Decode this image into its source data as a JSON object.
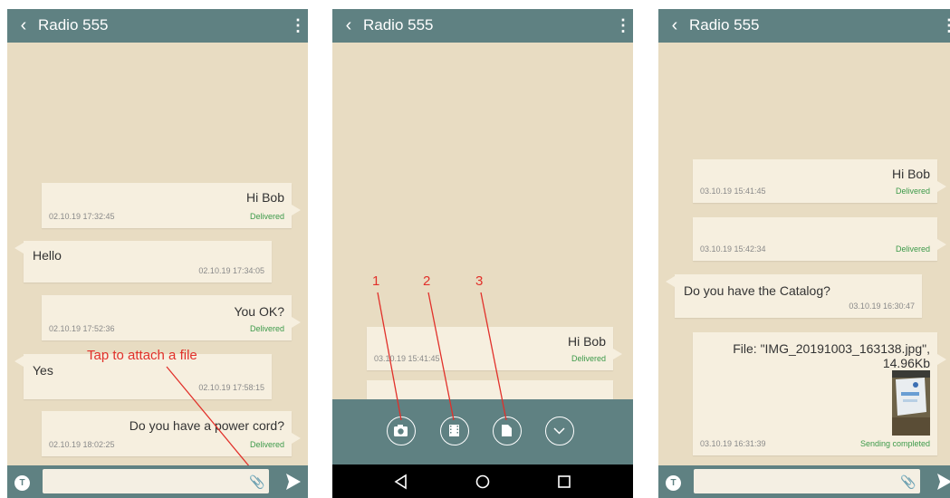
{
  "colors": {
    "header": "#5f8182",
    "chat_bg": "#e8dcc2",
    "bubble": "#f6efdf",
    "delivered": "#3d9a4a",
    "annotation": "#e1302a"
  },
  "screens": [
    {
      "title": "Radio 555",
      "messages": [
        {
          "dir": "out",
          "text": "Hi Bob",
          "time": "02.10.19 17:32:45",
          "status": "Delivered"
        },
        {
          "dir": "in",
          "text": "Hello",
          "time": "02.10.19 17:34:05"
        },
        {
          "dir": "out",
          "text": "You OK?",
          "time": "02.10.19 17:52:36",
          "status": "Delivered"
        },
        {
          "dir": "in",
          "text": "Yes",
          "time": "02.10.19 17:58:15"
        },
        {
          "dir": "out",
          "text": "Do you have a power cord?",
          "time": "02.10.19 18:02:25",
          "status": "Delivered"
        }
      ],
      "annotation": "Tap to  attach a file",
      "icons": {
        "back": "chevron-left-icon",
        "more": "more-vertical-icon",
        "text_mode": "t-icon",
        "attach": "paperclip-icon",
        "send": "send-icon"
      }
    },
    {
      "title": "Radio 555",
      "messages": [
        {
          "dir": "out",
          "text": "Hi Bob",
          "time": "03.10.19 15:41:45",
          "status": "Delivered"
        }
      ],
      "attach_options": [
        {
          "label": "1",
          "icon": "camera-icon"
        },
        {
          "label": "2",
          "icon": "video-film-icon"
        },
        {
          "label": "3",
          "icon": "file-icon"
        },
        {
          "icon": "chevron-down-icon"
        }
      ],
      "nav": [
        "back-triangle-icon",
        "home-circle-icon",
        "recents-square-icon"
      ]
    },
    {
      "title": "Radio 555",
      "messages": [
        {
          "dir": "out",
          "text": "Hi Bob",
          "time": "03.10.19 15:41:45",
          "status": "Delivered"
        },
        {
          "dir": "out",
          "text": "",
          "time": "03.10.19 15:42:34",
          "status": "Delivered"
        },
        {
          "dir": "in",
          "text": "Do you have the Catalog?",
          "time": "03.10.19 16:30:47"
        },
        {
          "dir": "out",
          "text": "File: \"IMG_20191003_163138.jpg\",",
          "text2": "14.96Kb",
          "time": "03.10.19 16:31:39",
          "status": "Sending completed"
        }
      ]
    }
  ]
}
